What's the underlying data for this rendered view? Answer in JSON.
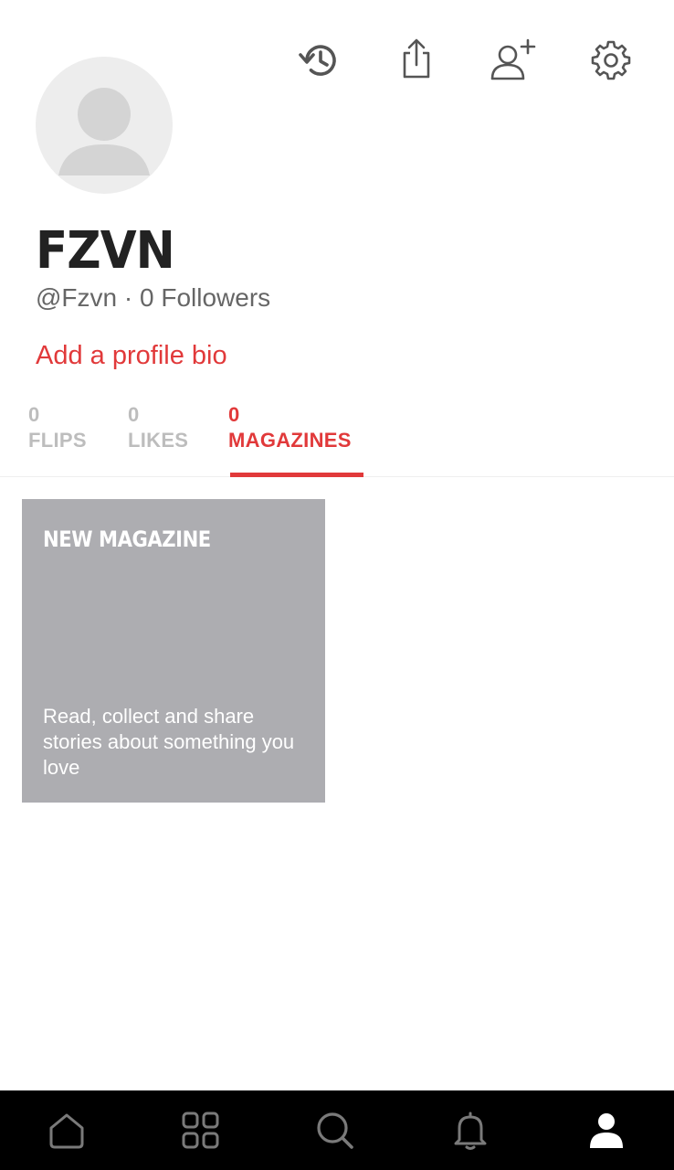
{
  "header": {
    "actions": [
      {
        "icon": "history-icon"
      },
      {
        "icon": "share-icon"
      },
      {
        "icon": "add-person-icon"
      },
      {
        "icon": "gear-icon"
      }
    ]
  },
  "profile": {
    "name": "FZVN",
    "subline": "@Fzvn · 0 Followers",
    "bio_link": "Add a profile bio"
  },
  "tabs": [
    {
      "count": "0",
      "label": "FLIPS",
      "active": false
    },
    {
      "count": "0",
      "label": "LIKES",
      "active": false
    },
    {
      "count": "0",
      "label": "MAGAZINES",
      "active": true
    }
  ],
  "magazine_card": {
    "title": "NEW MAGAZINE",
    "description": "Read, collect and share stories about something you love"
  },
  "bottom_nav": [
    {
      "icon": "home-icon",
      "active": false
    },
    {
      "icon": "grid-icon",
      "active": false
    },
    {
      "icon": "search-icon",
      "active": false
    },
    {
      "icon": "bell-icon",
      "active": false
    },
    {
      "icon": "profile-icon",
      "active": true
    }
  ],
  "colors": {
    "accent": "#e1393a",
    "card_bg": "#adadb1",
    "nav_bg": "#000000",
    "inactive_tab": "#bdbdbd"
  }
}
